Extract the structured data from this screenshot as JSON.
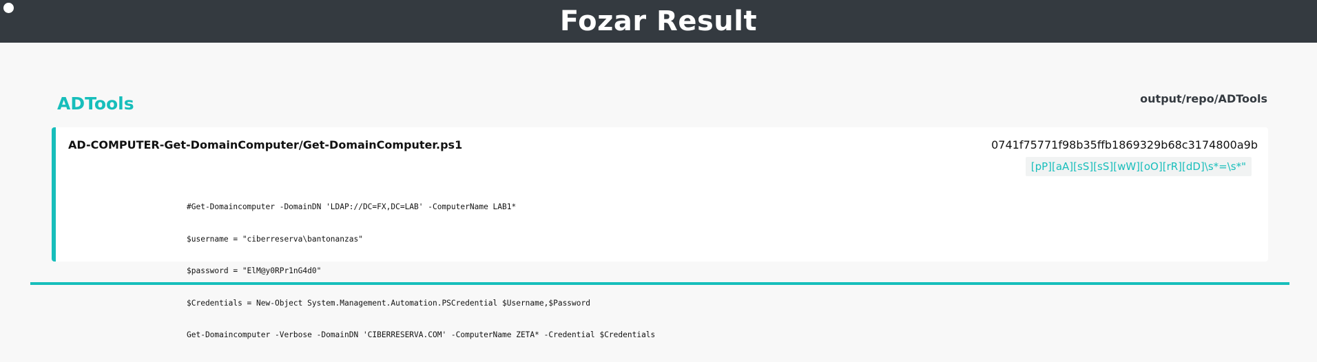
{
  "header": {
    "title": "Fozar Result"
  },
  "repo": {
    "name": "ADTools",
    "path": "output/repo/ADTools"
  },
  "result": {
    "file_path": "AD-COMPUTER-Get-DomainComputer/Get-DomainComputer.ps1",
    "commit_hash": "0741f75771f98b35ffb1869329b68c3174800a9b",
    "regex": "[pP][aA][sS][sS][wW][oO][rR][dD]\\s*=\\s*\"",
    "code_lines": [
      "#Get-Domaincomputer -DomainDN 'LDAP://DC=FX,DC=LAB' -ComputerName LAB1*",
      "$username = \"ciberreserva\\bantonanzas\"",
      "$password = \"ElM@y0RPr1nG4d0\"",
      "$Credentials = New-Object System.Management.Automation.PSCredential $Username,$Password",
      "Get-Domaincomputer -Verbose -DomainDN 'CIBERRESERVA.COM' -ComputerName ZETA* -Credential $Credentials"
    ]
  },
  "colors": {
    "accent": "#17bebb",
    "header_bg": "#343a40"
  }
}
